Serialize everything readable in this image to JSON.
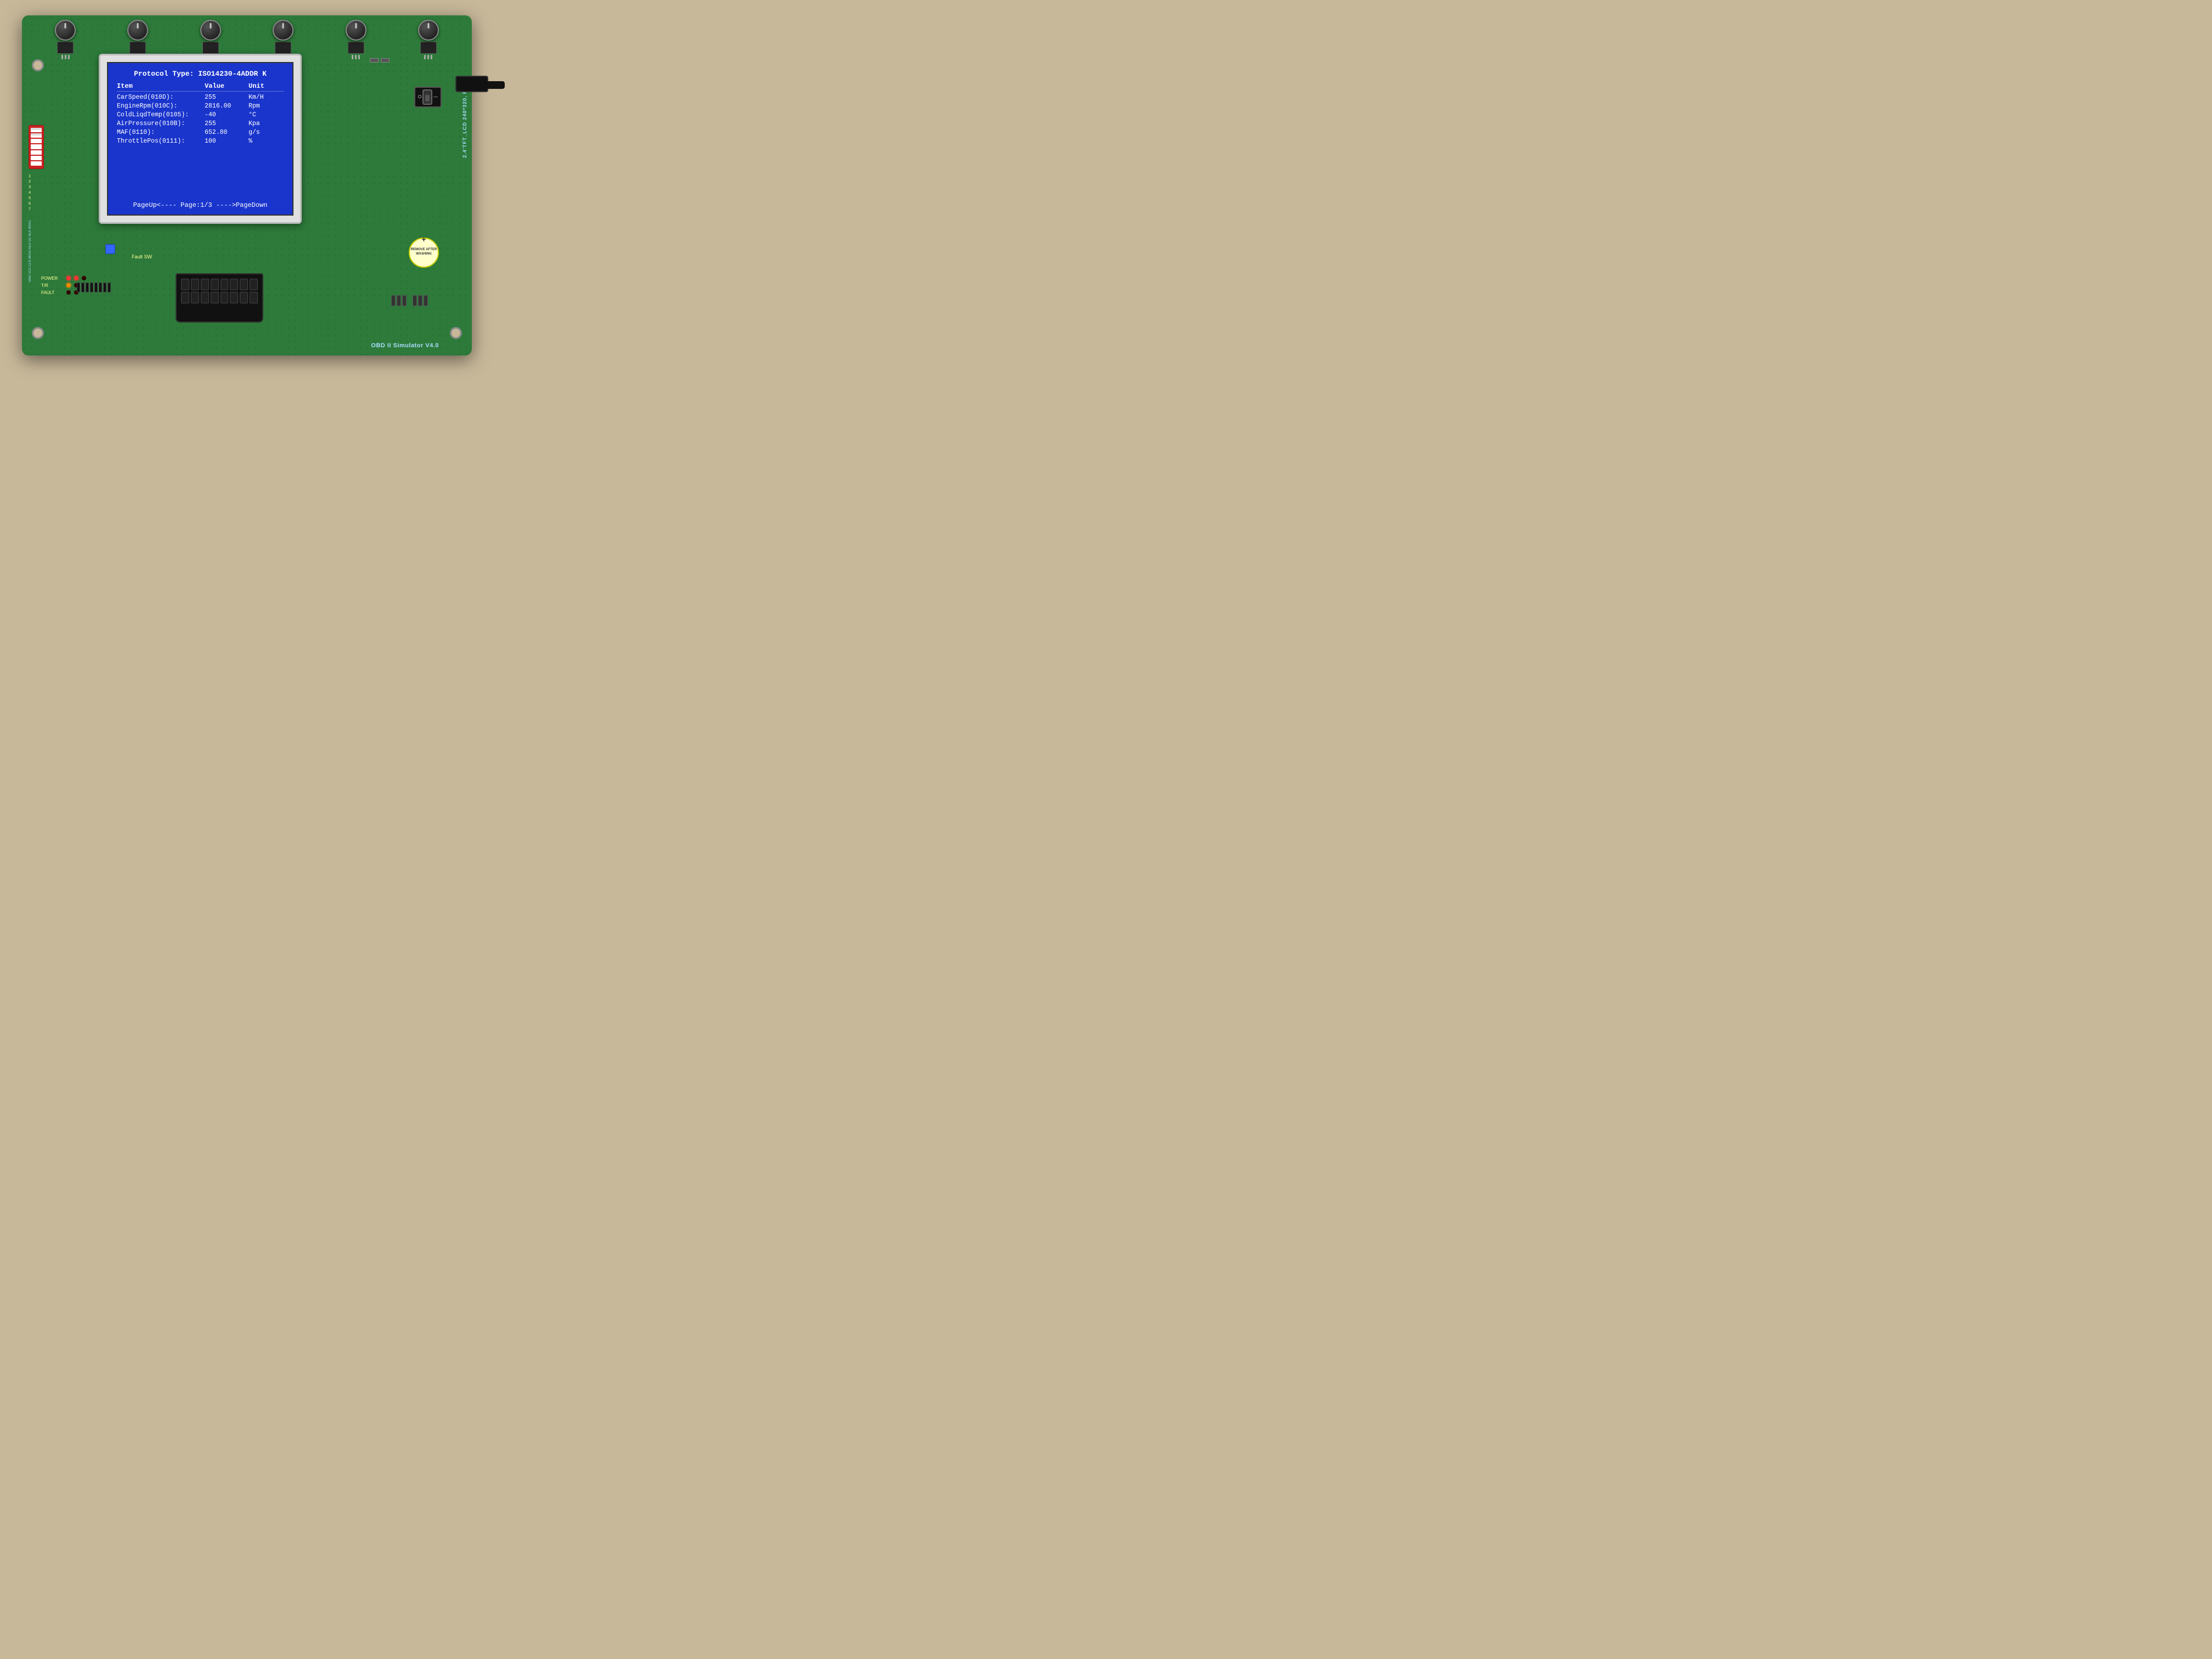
{
  "board": {
    "title": "OBD II Simulator V4.0",
    "lcd_label": "2.4'TFT_LCD 240*320, RGB"
  },
  "display": {
    "protocol_line": "Protocol Type: ISO14230-4ADDR K",
    "header": {
      "item": "Item",
      "value": "Value",
      "unit": "Unit"
    },
    "rows": [
      {
        "item": "CarSpeed(010D):",
        "value": "255",
        "unit": "Km/H"
      },
      {
        "item": "EngineRpm(010C):",
        "value": "2816.00",
        "unit": "Rpm"
      },
      {
        "item": "ColdLiqdTemp(0105):",
        "value": "-40",
        "unit": "°C"
      },
      {
        "item": "AirPressure(010B):",
        "value": "255",
        "unit": "Kpa"
      },
      {
        "item": "MAF(0110):",
        "value": "652.80",
        "unit": "g/s"
      },
      {
        "item": "ThrottlePos(0111):",
        "value": "100",
        "unit": "%"
      }
    ],
    "footer": "PageUp<---- Page:1/3 ---->PageDown"
  },
  "labels": {
    "fault_sw": "Fault SW",
    "power": "POWER",
    "tr": "T/R",
    "fault": "FAULT",
    "remove_sticker": "REMOVE AFTER WASHING",
    "obd_label": "OBD II Simulator V4.0",
    "power_on": "O",
    "power_off": "—"
  }
}
